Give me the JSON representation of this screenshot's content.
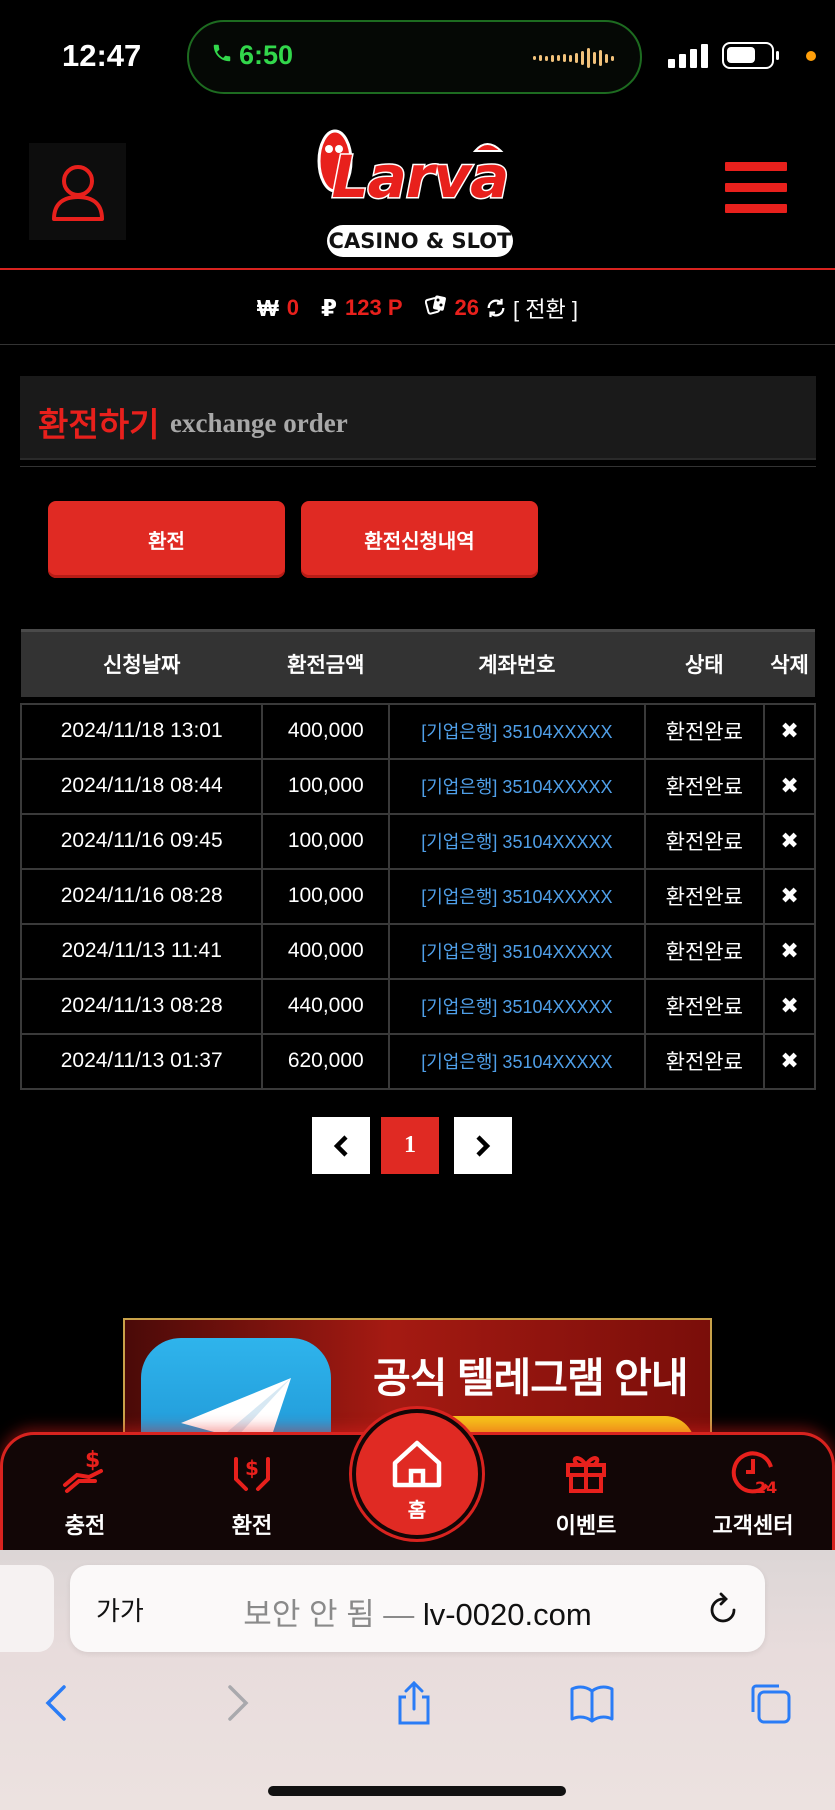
{
  "status_bar": {
    "time": "12:47",
    "call_time": "6:50"
  },
  "header": {
    "logo_text": "Larva",
    "logo_sub": "CASINO & SLOT"
  },
  "balance": {
    "won_symbol": "₩",
    "won_value": "0",
    "point_symbol": "₽",
    "point_value": "123 P",
    "chip_value": "26",
    "switch_label": "[ 전환 ]"
  },
  "section": {
    "title_ko": "환전하기",
    "title_en": "exchange order"
  },
  "buttons": {
    "exchange": "환전",
    "history": "환전신청내역"
  },
  "table": {
    "headers": [
      "신청날짜",
      "환전금액",
      "계좌번호",
      "상태",
      "삭제"
    ],
    "rows": [
      {
        "date": "2024/11/18 13:01",
        "amount": "400,000",
        "account": "[기업은행] 35104XXXXX",
        "status": "환전완료",
        "delete": "✖"
      },
      {
        "date": "2024/11/18 08:44",
        "amount": "100,000",
        "account": "[기업은행] 35104XXXXX",
        "status": "환전완료",
        "delete": "✖"
      },
      {
        "date": "2024/11/16 09:45",
        "amount": "100,000",
        "account": "[기업은행] 35104XXXXX",
        "status": "환전완료",
        "delete": "✖"
      },
      {
        "date": "2024/11/16 08:28",
        "amount": "100,000",
        "account": "[기업은행] 35104XXXXX",
        "status": "환전완료",
        "delete": "✖"
      },
      {
        "date": "2024/11/13 11:41",
        "amount": "400,000",
        "account": "[기업은행] 35104XXXXX",
        "status": "환전완료",
        "delete": "✖"
      },
      {
        "date": "2024/11/13 08:28",
        "amount": "440,000",
        "account": "[기업은행] 35104XXXXX",
        "status": "환전완료",
        "delete": "✖"
      },
      {
        "date": "2024/11/13 01:37",
        "amount": "620,000",
        "account": "[기업은행] 35104XXXXX",
        "status": "환전완료",
        "delete": "✖"
      }
    ]
  },
  "pagination": {
    "prev": "‹",
    "current": "1",
    "next": "›"
  },
  "banner": {
    "text": "공식 텔레그램 안내"
  },
  "bottom_nav": {
    "items": [
      {
        "label": "충전",
        "icon": "deposit-icon"
      },
      {
        "label": "환전",
        "icon": "withdraw-icon"
      },
      {
        "label": "홈",
        "icon": "home-icon"
      },
      {
        "label": "이벤트",
        "icon": "gift-icon"
      },
      {
        "label": "고객센터",
        "icon": "support-24-icon"
      }
    ]
  },
  "browser": {
    "aa_label": "가가",
    "insecure_label": "보안 안 됨 —",
    "domain": "lv-0020.com"
  },
  "colors": {
    "accent": "#e02a23",
    "link": "#4f9fe8",
    "call_green": "#32d74b"
  }
}
